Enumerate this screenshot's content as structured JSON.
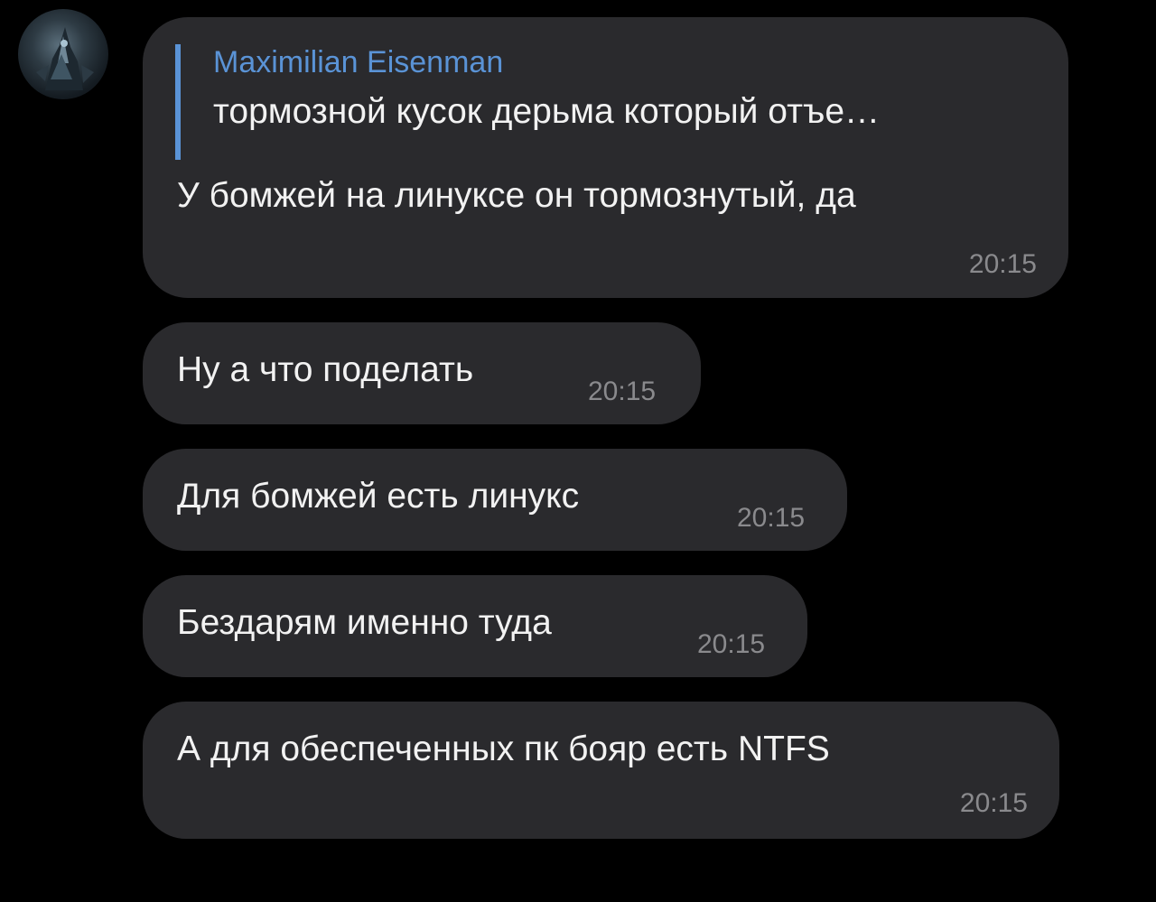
{
  "avatar": {
    "icon": "user-avatar-icon"
  },
  "messages": [
    {
      "reply": {
        "author": "Maximilian Eisenman",
        "text": "тормозной кусок дерьма который отъе…"
      },
      "text": "У бомжей на линуксе он тормознутый, да",
      "time": "20:15"
    },
    {
      "text": "Ну а что поделать",
      "time": "20:15"
    },
    {
      "text": "Для бомжей есть линукс",
      "time": "20:15"
    },
    {
      "text": "Бездарям именно туда",
      "time": "20:15"
    },
    {
      "text": "А для обеспеченных пк бояр есть NTFS",
      "time": "20:15"
    }
  ],
  "colors": {
    "background": "#000000",
    "bubble": "#2a2a2d",
    "accent": "#5a93d6",
    "text": "#f2f2f2",
    "time": "#8a8a8d"
  }
}
